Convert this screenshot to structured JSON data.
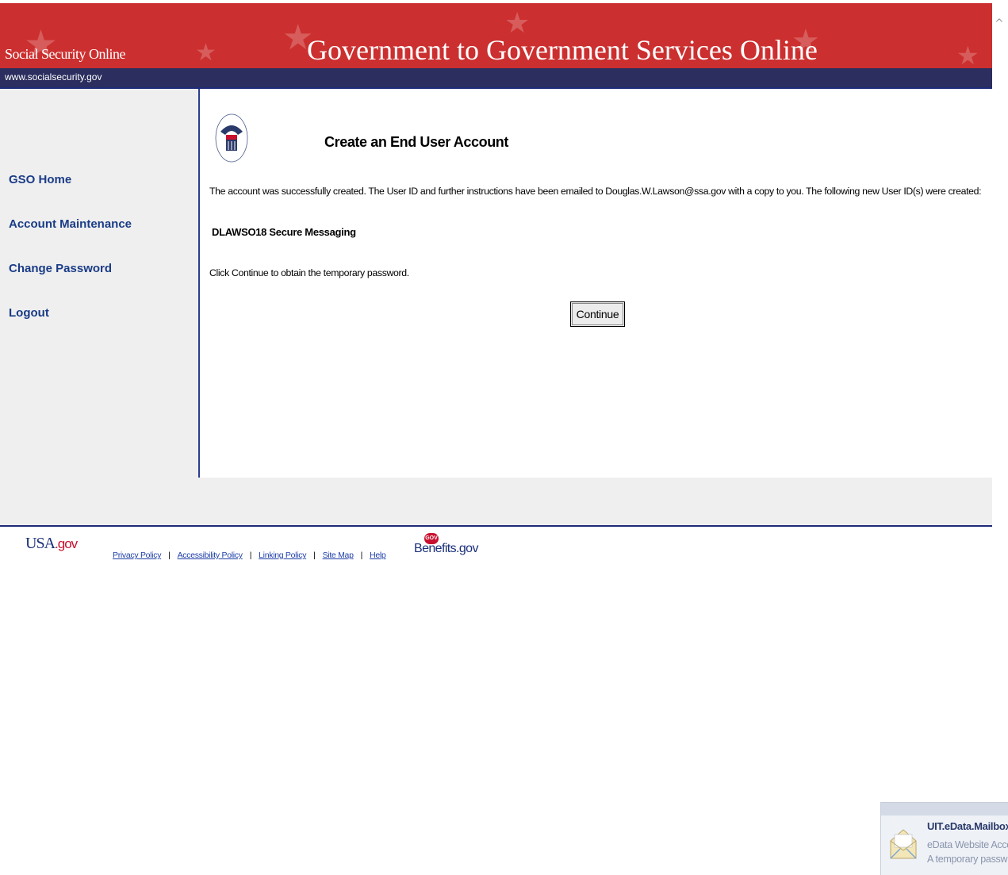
{
  "header": {
    "site_name": "Social Security Online",
    "title": "Government to Government Services Online",
    "url": "www.socialsecurity.gov"
  },
  "sidebar": {
    "items": [
      {
        "label": "GSO Home"
      },
      {
        "label": "Account Maintenance"
      },
      {
        "label": "Change Password"
      },
      {
        "label": "Logout"
      }
    ]
  },
  "main": {
    "seal_icon": "ssa-seal-icon",
    "title": "Create an End User Account",
    "message": "The account was successfully created. The User ID and further instructions have been emailed to Douglas.W.Lawson@ssa.gov with a copy to you. The following new User ID(s) were created:",
    "user_id_line": "DLAWSO18 Secure Messaging",
    "instructions": "Click Continue to obtain the temporary password.",
    "continue_label": "Continue"
  },
  "footer": {
    "usa_logo": "USA",
    "usa_logo_suffix": ".gov",
    "links": [
      {
        "label": "Privacy Policy"
      },
      {
        "label": "Accessibility Policy"
      },
      {
        "label": "Linking Policy"
      },
      {
        "label": "Site Map"
      },
      {
        "label": "Help"
      }
    ],
    "benefits_logo": "Benefits",
    "benefits_suffix": ".gov",
    "benefits_badge": "GOV"
  },
  "notification": {
    "title": "UIT.eData.Mailbox",
    "line1": "eData Website Acce",
    "line2": "A temporary passw"
  },
  "colors": {
    "banner_red": "#cc2f2f",
    "navy": "#2b2e5e",
    "link_blue": "#1a3c87",
    "sidebar_gray": "#efefef"
  }
}
